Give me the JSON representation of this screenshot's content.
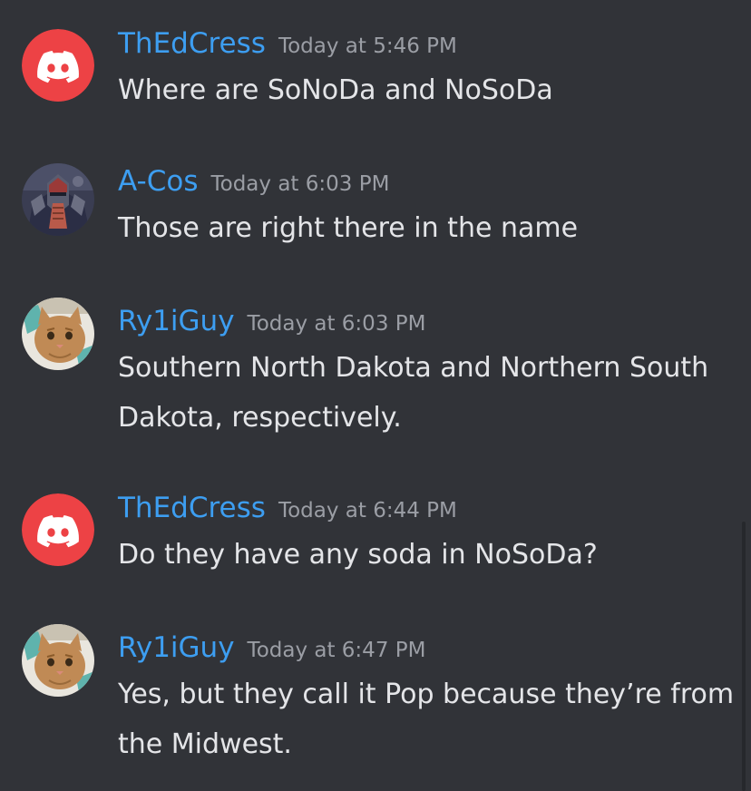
{
  "messages": [
    {
      "username": "ThEdCress",
      "timestamp": "Today at 5:46 PM",
      "text": "Where are SoNoDa and NoSoDa",
      "avatar": "discord-logo-avatar",
      "avatar_color": "#ed4245"
    },
    {
      "username": "A-Cos",
      "timestamp": "Today at 6:03 PM",
      "text": "Those are right there in the name",
      "avatar": "robot-warrior-avatar"
    },
    {
      "username": "Ry1iGuy",
      "timestamp": "Today at 6:03 PM",
      "text": "Southern North Dakota and Northern South Dakota, respectively.",
      "avatar": "cat-avatar"
    },
    {
      "username": "ThEdCress",
      "timestamp": "Today at 6:44 PM",
      "text": "Do they have any soda in NoSoDa?",
      "avatar": "discord-logo-avatar",
      "avatar_color": "#ed4245"
    },
    {
      "username": "Ry1iGuy",
      "timestamp": "Today at 6:47 PM",
      "text": "Yes, but they call it Pop because they’re from the Midwest.",
      "avatar": "cat-avatar"
    }
  ],
  "colors": {
    "background": "#313338",
    "username": "#3d9ef1",
    "timestamp": "#9b9ea5",
    "text": "#e4e5e8"
  }
}
